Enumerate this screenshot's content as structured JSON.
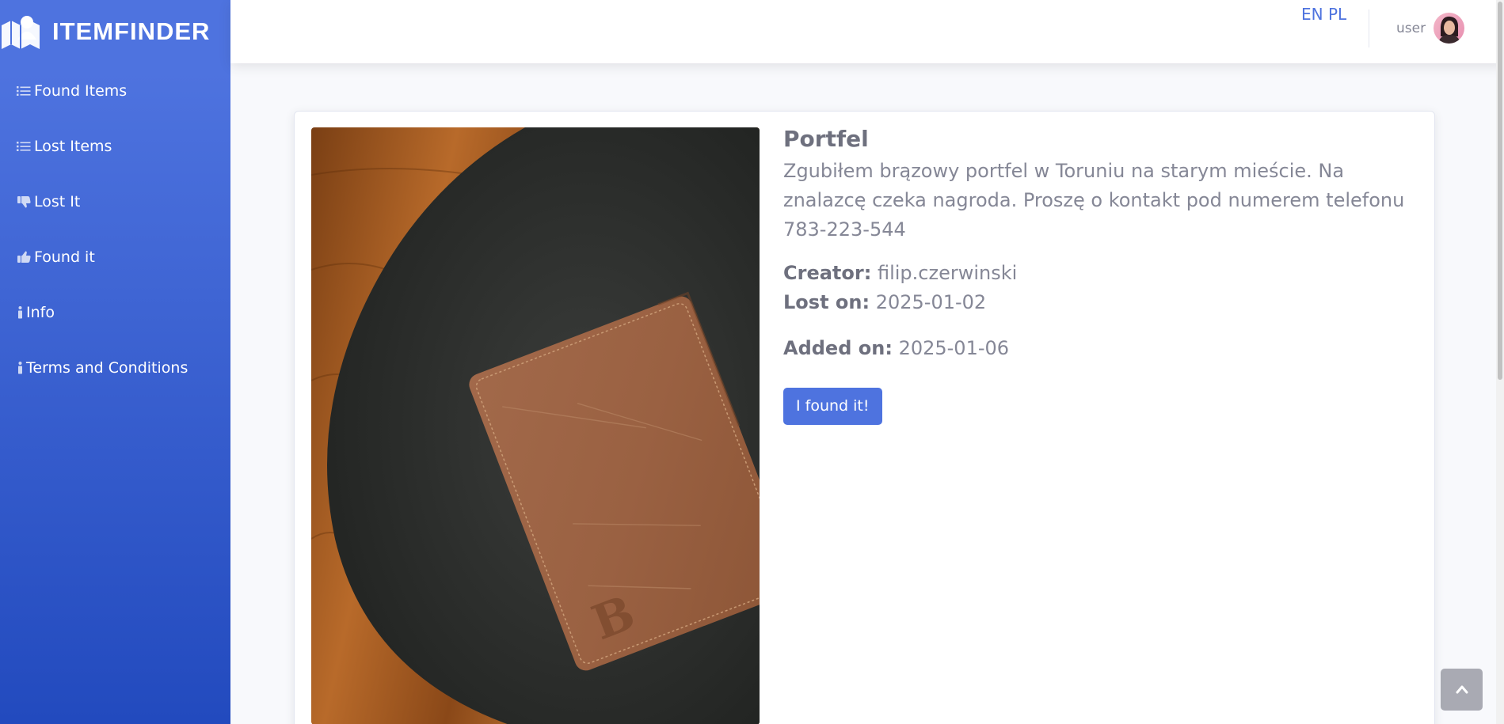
{
  "brand": {
    "name": "ITEMFINDER",
    "logo_icon": "map-user-icon"
  },
  "sidebar": {
    "items": [
      {
        "label": "Found Items",
        "icon": "list-icon"
      },
      {
        "label": "Lost Items",
        "icon": "list-icon"
      },
      {
        "label": "Lost It",
        "icon": "thumbs-down-icon"
      },
      {
        "label": "Found it",
        "icon": "thumbs-up-icon"
      },
      {
        "label": "Info",
        "icon": "info-icon"
      },
      {
        "label": "Terms and Conditions",
        "icon": "info-icon"
      }
    ]
  },
  "topbar": {
    "languages": [
      "EN",
      "PL"
    ],
    "user_label": "user"
  },
  "item": {
    "title": "Portfel",
    "description": "Zgubiłem brązowy portfel w Toruniu na starym mieście. Na znalazcę czeka nagroda. Proszę o kontakt pod numerem telefonu 783-223-544",
    "creator_label": "Creator:",
    "creator_value": "filip.czerwinski",
    "lost_on_label": "Lost on:",
    "lost_on_value": "2025-01-02",
    "added_on_label": "Added on:",
    "added_on_value": "2025-01-06",
    "action_label": "I found it!"
  },
  "colors": {
    "primary": "#4e73df",
    "sidebar_bottom": "#224abe",
    "text_muted": "#858796"
  }
}
